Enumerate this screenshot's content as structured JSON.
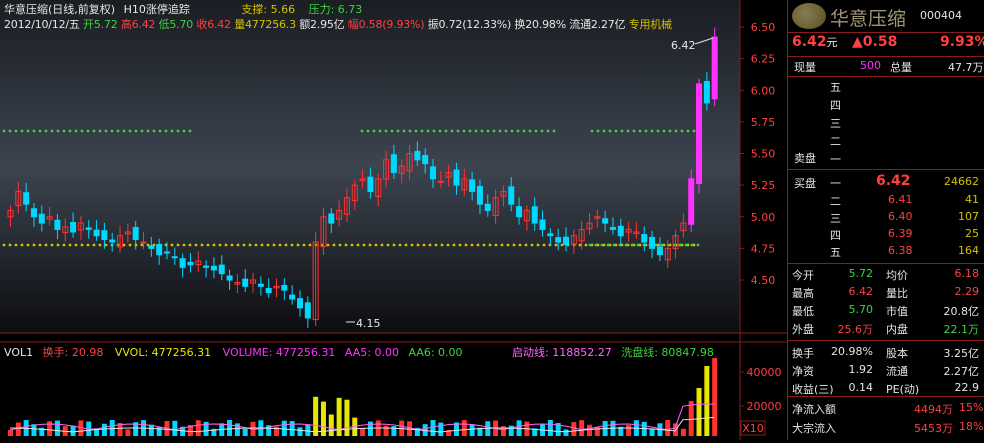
{
  "header": {
    "title": "华意压缩(日线,前复权)",
    "indicator": "H10涨停追踪",
    "support": "支撑: 5.66",
    "pressure": "压力: 6.73",
    "date": "2012/10/12/五",
    "open": "开5.72",
    "high": "高6.42",
    "low": "低5.70",
    "close": "收6.42",
    "volume": "量477256.3",
    "amount": "额2.95亿",
    "change": "幅0.58(9.93%)",
    "amplitude": "振0.72(12.33%)",
    "turnover": "换20.98%",
    "float_cap": "流通2.27亿",
    "sector": "专用机械"
  },
  "price_axis": {
    "ticks": [
      "6.50",
      "6.25",
      "6.00",
      "5.75",
      "5.50",
      "5.25",
      "5.00",
      "4.75",
      "4.50"
    ]
  },
  "annotations": {
    "high_mark": "6.42",
    "low_mark": "4.15"
  },
  "volume_header": {
    "name": "VOL1",
    "huanshou": "换手: 20.98",
    "vvol": "VVOL: 477256.31",
    "volume": "VOLUME: 477256.31",
    "aa5": "AA5: 0.00",
    "aa6": "AA6: 0.00",
    "qidong": "启动线: 118852.27",
    "xipan": "洗盘线: 80847.98"
  },
  "volume_axis": {
    "ticks": [
      "40000",
      "20000"
    ],
    "unit": "X10"
  },
  "quote": {
    "name": "华意压缩",
    "code": "000404",
    "price": "6.42",
    "price_unit": "元",
    "change": "▲0.58",
    "change_pct": "9.93%",
    "xianliang_label": "现量",
    "xianliang": "500",
    "zongliang_label": "总量",
    "zongliang": "47.7万",
    "sell_side_label": "卖盘",
    "sell_levels": [
      "五",
      "四",
      "三",
      "二",
      "一"
    ],
    "buy_side_label": "买盘",
    "buy_levels": [
      {
        "level": "一",
        "price": "6.42",
        "vol": "24662"
      },
      {
        "level": "二",
        "price": "6.41",
        "vol": "41"
      },
      {
        "level": "三",
        "price": "6.40",
        "vol": "107"
      },
      {
        "level": "四",
        "price": "6.39",
        "vol": "25"
      },
      {
        "level": "五",
        "price": "6.38",
        "vol": "164"
      }
    ],
    "stats": [
      {
        "l1": "今开",
        "v1": "5.72",
        "c1": "#3fd23f",
        "l2": "均价",
        "v2": "6.18",
        "c2": "#ff4040"
      },
      {
        "l1": "最高",
        "v1": "6.42",
        "c1": "#ff4040",
        "l2": "量比",
        "v2": "2.29",
        "c2": "#ff4040"
      },
      {
        "l1": "最低",
        "v1": "5.70",
        "c1": "#3fd23f",
        "l2": "市值",
        "v2": "20.8亿",
        "c2": "#e6e6e6"
      },
      {
        "l1": "外盘",
        "v1": "25.6万",
        "c1": "#ff4040",
        "l2": "内盘",
        "v2": "22.1万",
        "c2": "#3fd23f"
      }
    ],
    "stats2": [
      {
        "l1": "换手",
        "v1": "20.98%",
        "l2": "股本",
        "v2": "3.25亿"
      },
      {
        "l1": "净资",
        "v1": "1.92",
        "l2": "流通",
        "v2": "2.27亿"
      },
      {
        "l1": "收益(三)",
        "v1": "0.14",
        "l2": "PE(动)",
        "v2": "22.9"
      }
    ],
    "netflow_label": "净流入额",
    "netflow": "4494万",
    "netflow_pct": "15%",
    "bigflow_label": "大宗流入",
    "bigflow": "5453万",
    "bigflow_pct": "18%"
  },
  "colors": {
    "up": "#ff3232",
    "down": "#00d8ff",
    "limit": "#ff33ff",
    "support": "#3fd23f",
    "gold": "#d4c000",
    "grid": "#8b1a1a"
  }
}
